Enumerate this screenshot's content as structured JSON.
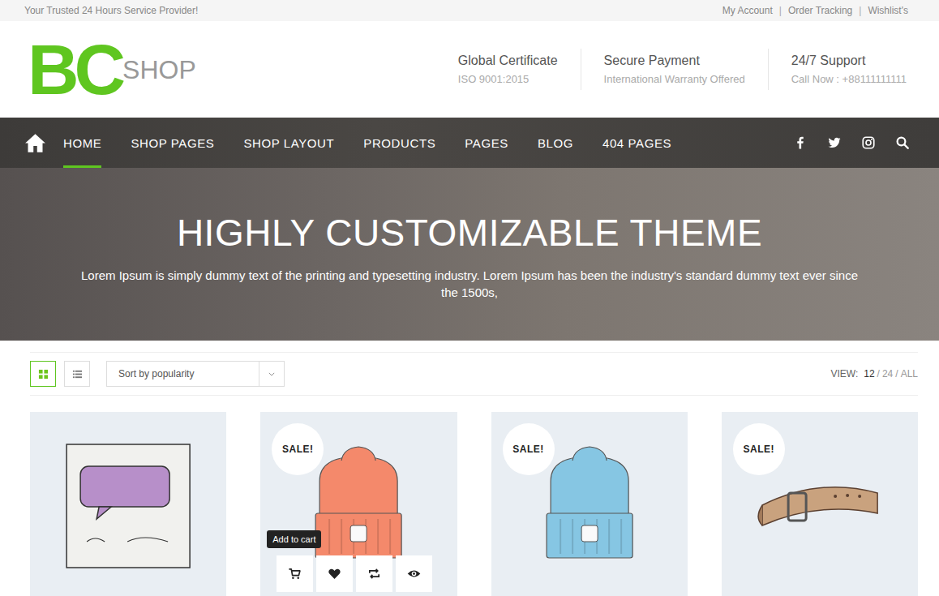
{
  "topbar": {
    "tagline": "Your Trusted 24 Hours Service Provider!",
    "links": [
      "My Account",
      "Order Tracking",
      "Wishlist's"
    ],
    "separator": "|"
  },
  "logo": {
    "mark": "BC",
    "word": "SHOP"
  },
  "features": [
    {
      "title": "Global Certificate",
      "subtitle": "ISO 9001:2015"
    },
    {
      "title": "Secure Payment",
      "subtitle": "International Warranty Offered"
    },
    {
      "title": "24/7 Support",
      "subtitle": "Call Now : +88111111111"
    }
  ],
  "nav": {
    "items": [
      {
        "label": "HOME",
        "selected": true
      },
      {
        "label": "SHOP PAGES",
        "selected": false
      },
      {
        "label": "SHOP LAYOUT",
        "selected": false
      },
      {
        "label": "PRODUCTS",
        "selected": false
      },
      {
        "label": "PAGES",
        "selected": false
      },
      {
        "label": "BLOG",
        "selected": false
      },
      {
        "label": "404 PAGES",
        "selected": false
      }
    ]
  },
  "hero": {
    "title": "HIGHLY CUSTOMIZABLE THEME",
    "text": "Lorem Ipsum is simply dummy text of the printing and typesetting industry. Lorem Ipsum has been the industry's standard dummy text ever since the 1500s,"
  },
  "toolbar": {
    "views": [
      {
        "name": "grid",
        "selected": true
      },
      {
        "name": "list",
        "selected": false
      }
    ],
    "sort": "Sort by popularity",
    "view_label": "VIEW:",
    "per_page": [
      {
        "label": "12",
        "selected": true
      },
      {
        "label": "24",
        "selected": false
      },
      {
        "label": "ALL",
        "selected": false
      }
    ],
    "separator": "/"
  },
  "products": [
    {
      "kind": "album",
      "sale": false,
      "hovered": false,
      "color": "#b78fc9"
    },
    {
      "kind": "beanie",
      "sale": true,
      "hovered": true,
      "color": "#f4896b"
    },
    {
      "kind": "beanie",
      "sale": true,
      "hovered": false,
      "color": "#86c6e3"
    },
    {
      "kind": "belt",
      "sale": true,
      "hovered": false,
      "color": "#c9a27e"
    }
  ],
  "badge": "SALE!",
  "tooltip": "Add to cart"
}
